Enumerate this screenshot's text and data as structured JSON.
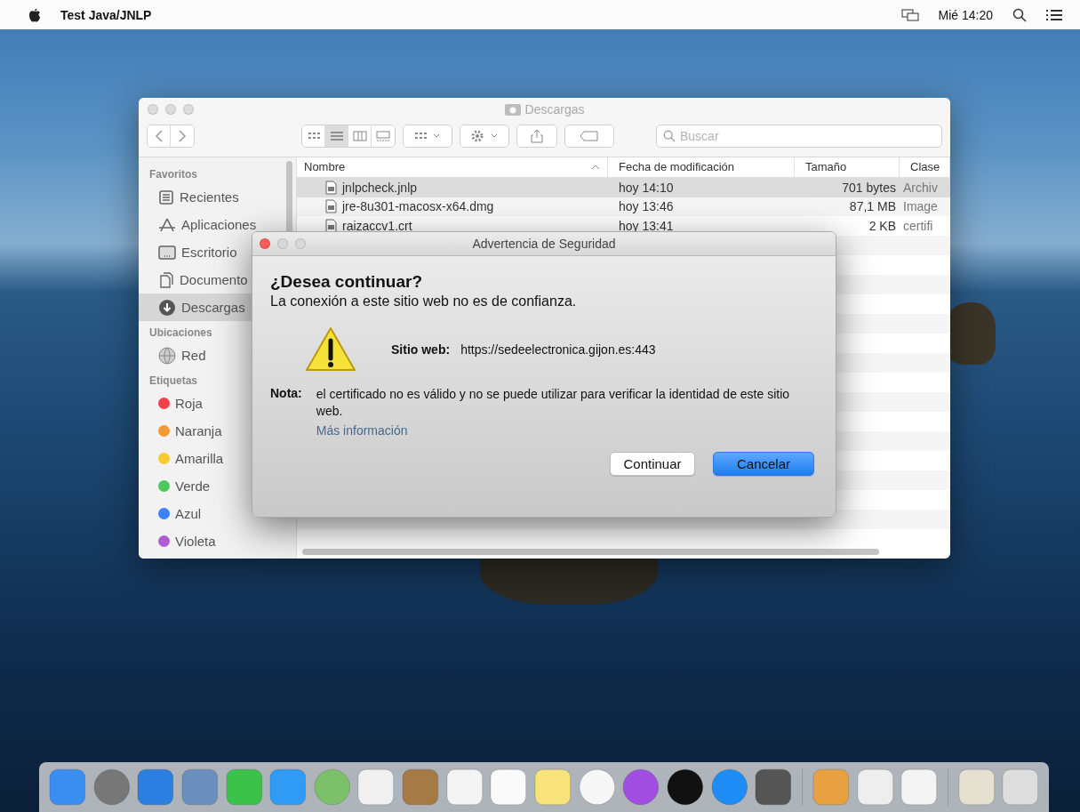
{
  "menubar": {
    "app_name": "Test Java/JNLP",
    "clock": "Mié 14:20"
  },
  "finder": {
    "title": "Descargas",
    "search": {
      "placeholder": "Buscar"
    },
    "sidebar": [
      {
        "heading": "Favoritos",
        "items": [
          {
            "label": "Recientes",
            "kind": "recent",
            "selected": false
          },
          {
            "label": "Aplicaciones",
            "kind": "apps",
            "selected": false
          },
          {
            "label": "Escritorio",
            "kind": "desktop",
            "selected": false
          },
          {
            "label": "Documento",
            "kind": "documents",
            "selected": false
          },
          {
            "label": "Descargas",
            "kind": "downloads",
            "selected": true
          }
        ]
      },
      {
        "heading": "Ubicaciones",
        "items": [
          {
            "label": "Red",
            "kind": "network",
            "selected": false
          }
        ]
      },
      {
        "heading": "Etiquetas",
        "items": [
          {
            "label": "Roja",
            "kind": "tag",
            "color": "#f2404a",
            "selected": false
          },
          {
            "label": "Naranja",
            "kind": "tag",
            "color": "#f59a33",
            "selected": false
          },
          {
            "label": "Amarilla",
            "kind": "tag",
            "color": "#f7cb30",
            "selected": false
          },
          {
            "label": "Verde",
            "kind": "tag",
            "color": "#4dc95a",
            "selected": false
          },
          {
            "label": "Azul",
            "kind": "tag",
            "color": "#3b82f6",
            "selected": false
          },
          {
            "label": "Violeta",
            "kind": "tag",
            "color": "#b05bd6",
            "selected": false
          }
        ]
      }
    ],
    "columns": [
      "Nombre",
      "Fecha de modificación",
      "Tamaño",
      "Clase"
    ],
    "rows": [
      {
        "name": "jnlpcheck.jnlp",
        "date": "hoy 14:10",
        "size": "701 bytes",
        "kind": "Archiv",
        "selected": true
      },
      {
        "name": "jre-8u301-macosx-x64.dmg",
        "date": "hoy 13:46",
        "size": "87,1 MB",
        "kind": "Image",
        "selected": false
      },
      {
        "name": "raizaccv1.crt",
        "date": "hoy 13:41",
        "size": "2 KB",
        "kind": "certifi",
        "selected": false
      }
    ]
  },
  "dialog": {
    "title": "Advertencia de Seguridad",
    "heading": "¿Desea continuar?",
    "subheading": "La conexión a este sitio web no es de confianza.",
    "site_label": "Sitio web:",
    "site_url": "https://sedeelectronica.gijon.es:443",
    "note_label": "Nota:",
    "note_text": "el certificado no es válido y no se puede utilizar para verificar la identidad de este sitio web.",
    "link": "Más información",
    "buttons": [
      {
        "label": "Continuar",
        "default": false
      },
      {
        "label": "Cancelar",
        "default": true
      }
    ]
  }
}
